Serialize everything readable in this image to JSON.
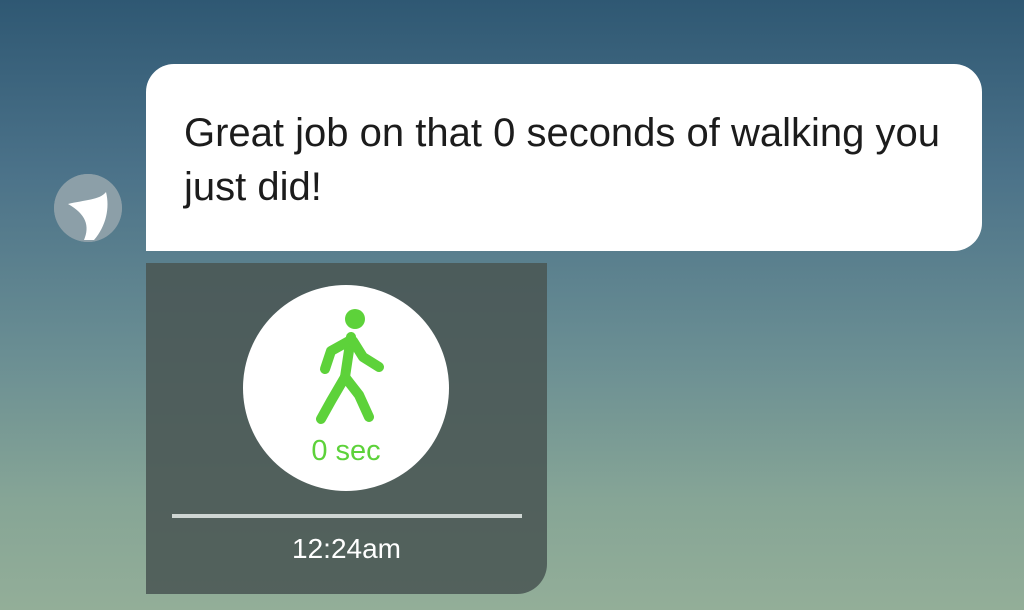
{
  "message": {
    "text": "Great job on that 0 seconds of walking you just did!"
  },
  "activity_card": {
    "icon": "walking-person-icon",
    "icon_color": "#5dd23a",
    "duration": "0 sec",
    "timestamp": "12:24am"
  }
}
